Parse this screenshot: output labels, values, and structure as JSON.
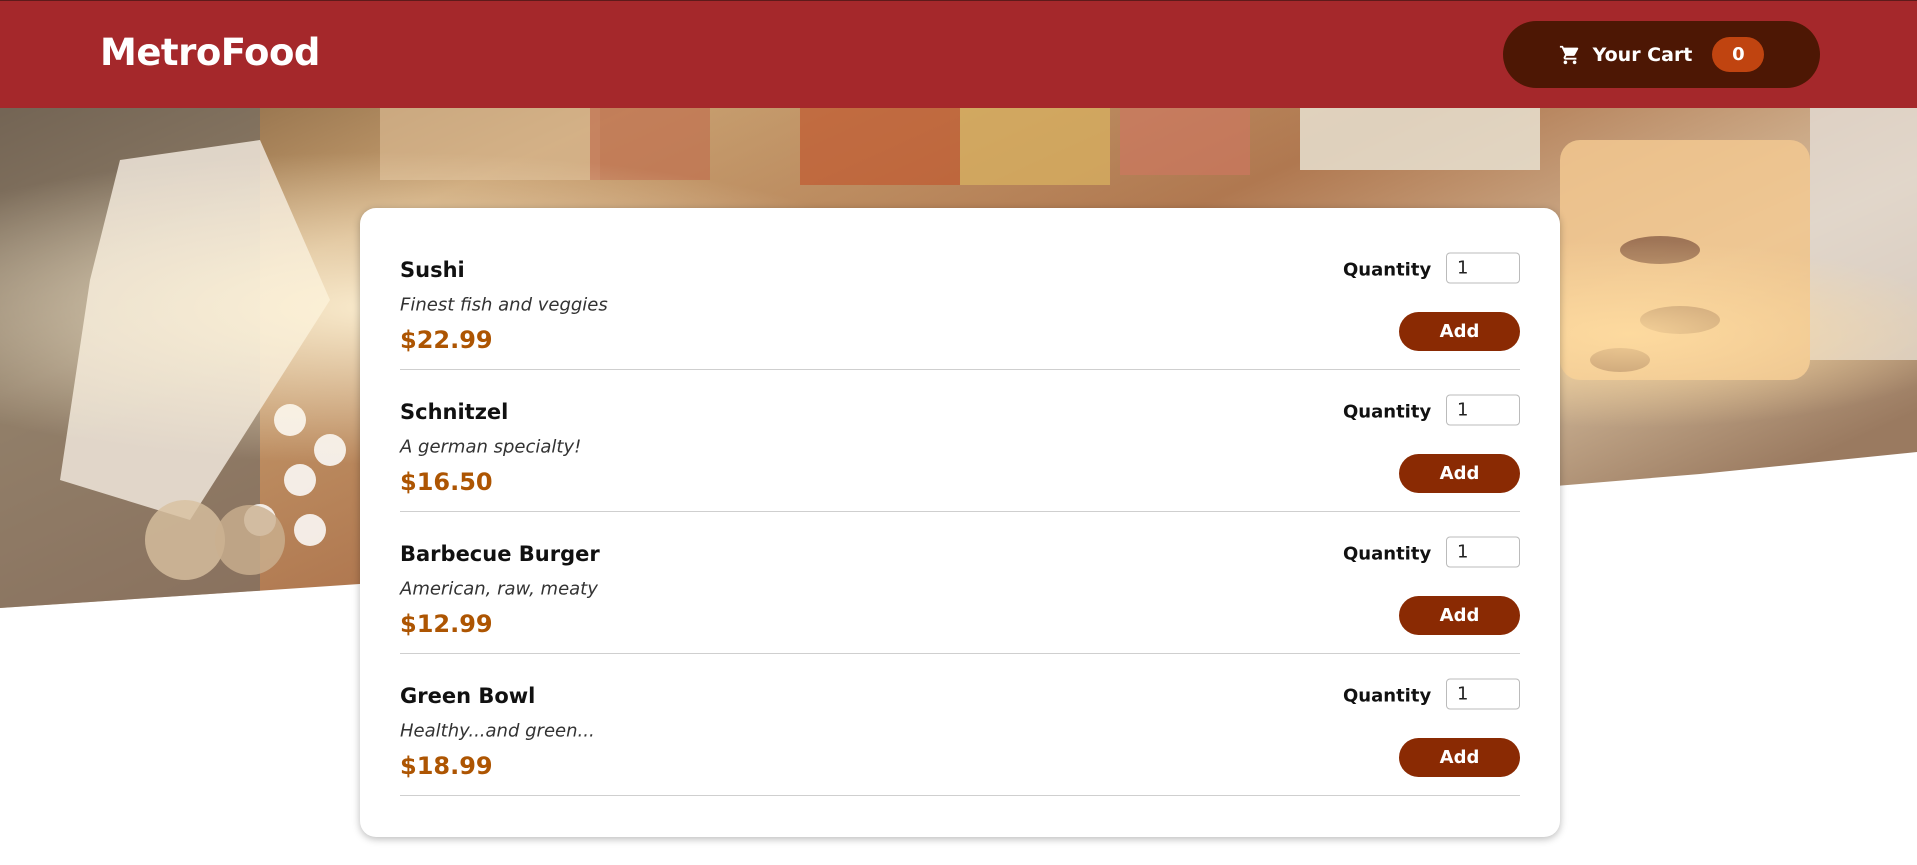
{
  "header": {
    "brand": "MetroFood",
    "cart_label": "Your Cart",
    "cart_count": "0"
  },
  "hero": {
    "description": "Banquet buffet table photo"
  },
  "menu": {
    "quantity_label": "Quantity",
    "add_label": "Add",
    "meals": [
      {
        "name": "Sushi",
        "description": "Finest fish and veggies",
        "price": "$22.99",
        "quantity": "1"
      },
      {
        "name": "Schnitzel",
        "description": "A german specialty!",
        "price": "$16.50",
        "quantity": "1"
      },
      {
        "name": "Barbecue Burger",
        "description": "American, raw, meaty",
        "price": "$12.99",
        "quantity": "1"
      },
      {
        "name": "Green Bowl",
        "description": "Healthy...and green...",
        "price": "$18.99",
        "quantity": "1"
      }
    ]
  },
  "colors": {
    "header_bg": "#a5282b",
    "cart_bg": "#4d1704",
    "badge_bg": "#c04410",
    "button_bg": "#8a2a03",
    "price": "#ad5502"
  },
  "icons": {
    "cart": "shopping-cart-icon"
  }
}
